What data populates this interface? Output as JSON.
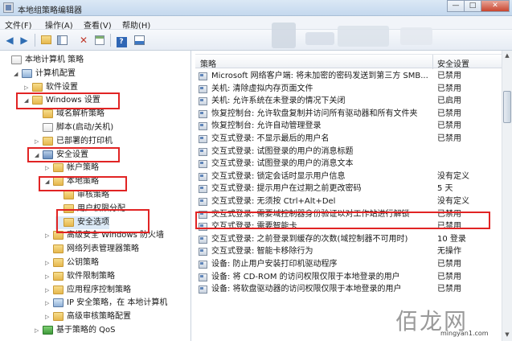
{
  "window": {
    "title": "本地组策略编辑器",
    "controls": [
      "—",
      "□",
      "✕"
    ]
  },
  "menu": [
    "文件(F)",
    "操作(A)",
    "查看(V)",
    "帮助(H)"
  ],
  "toolbar_icons": [
    "back-arrow-icon",
    "forward-arrow-icon",
    "up-folder-icon",
    "show-hide-tree-icon",
    "delete-icon",
    "export-list-icon",
    "help-icon",
    "properties-icon"
  ],
  "tree": [
    {
      "label": "本地计算机 策略",
      "level": 0,
      "icon": "doc",
      "expander": ""
    },
    {
      "label": "计算机配置",
      "level": 1,
      "icon": "computer",
      "expander": "◢"
    },
    {
      "label": "软件设置",
      "level": 2,
      "icon": "folder",
      "expander": "▷"
    },
    {
      "label": "Windows 设置",
      "level": 2,
      "icon": "folder",
      "expander": "◢"
    },
    {
      "label": "域名解析策略",
      "level": 3,
      "icon": "folder",
      "expander": ""
    },
    {
      "label": "脚本(启动/关机)",
      "level": 3,
      "icon": "doc",
      "expander": ""
    },
    {
      "label": "已部署的打印机",
      "level": 3,
      "icon": "folder",
      "expander": "▷"
    },
    {
      "label": "安全设置",
      "level": 3,
      "icon": "shield",
      "expander": "◢"
    },
    {
      "label": "帐户策略",
      "level": 4,
      "icon": "folder",
      "expander": "▷"
    },
    {
      "label": "本地策略",
      "level": 4,
      "icon": "folder",
      "expander": "◢"
    },
    {
      "label": "审核策略",
      "level": 5,
      "icon": "folder",
      "expander": ""
    },
    {
      "label": "用户权限分配",
      "level": 5,
      "icon": "folder",
      "expander": ""
    },
    {
      "label": "安全选项",
      "level": 5,
      "icon": "folder",
      "expander": ""
    },
    {
      "label": "高级安全 Windows 防火墙",
      "level": 4,
      "icon": "folder",
      "expander": "▷"
    },
    {
      "label": "网络列表管理器策略",
      "level": 4,
      "icon": "folder",
      "expander": ""
    },
    {
      "label": "公钥策略",
      "level": 4,
      "icon": "folder",
      "expander": "▷"
    },
    {
      "label": "软件限制策略",
      "level": 4,
      "icon": "folder",
      "expander": "▷"
    },
    {
      "label": "应用程序控制策略",
      "level": 4,
      "icon": "folder",
      "expander": "▷"
    },
    {
      "label": "IP 安全策略，在 本地计算机",
      "level": 4,
      "icon": "computer",
      "expander": "▷"
    },
    {
      "label": "高级审核策略配置",
      "level": 4,
      "icon": "folder",
      "expander": "▷"
    },
    {
      "label": "基于策略的 QoS",
      "level": 3,
      "icon": "chart",
      "expander": "▷"
    }
  ],
  "list": {
    "columns": {
      "policy": "策略",
      "setting": "安全设置"
    },
    "rows": [
      {
        "name": "Microsoft 网络客户端: 将未加密的密码发送到第三方 SMB...",
        "setting": "已禁用"
      },
      {
        "name": "关机: 清除虚拟内存页面文件",
        "setting": "已禁用"
      },
      {
        "name": "关机: 允许系统在未登录的情况下关闭",
        "setting": "已启用"
      },
      {
        "name": "恢复控制台: 允许软盘复制并访问所有驱动器和所有文件夹",
        "setting": "已禁用"
      },
      {
        "name": "恢复控制台: 允许自动管理登录",
        "setting": "已禁用"
      },
      {
        "name": "交互式登录: 不显示最后的用户名",
        "setting": "已禁用"
      },
      {
        "name": "交互式登录: 试图登录的用户的消息标题",
        "setting": ""
      },
      {
        "name": "交互式登录: 试图登录的用户的消息文本",
        "setting": ""
      },
      {
        "name": "交互式登录: 锁定会话时显示用户信息",
        "setting": "没有定义"
      },
      {
        "name": "交互式登录: 提示用户在过期之前更改密码",
        "setting": "5 天"
      },
      {
        "name": "交互式登录: 无须按 Ctrl+Alt+Del",
        "setting": "没有定义"
      },
      {
        "name": "交互式登录: 需要域控制器身份验证以对工作站进行解锁",
        "setting": "已禁用"
      },
      {
        "name": "交互式登录: 需要智能卡",
        "setting": "已禁用"
      },
      {
        "name": "交互式登录: 之前登录到缓存的次数(域控制器不可用时)",
        "setting": "10 登录"
      },
      {
        "name": "交互式登录: 智能卡移除行为",
        "setting": "无操作"
      },
      {
        "name": "设备: 防止用户安装打印机驱动程序",
        "setting": "已禁用"
      },
      {
        "name": "设备: 将 CD-ROM 的访问权限仅限于本地登录的用户",
        "setting": "已禁用"
      },
      {
        "name": "设备: 将软盘驱动器的访问权限仅限于本地登录的用户",
        "setting": "已禁用"
      }
    ]
  },
  "watermark": {
    "glyphs": "佰龙网",
    "url": "mingyan1.com"
  },
  "colors": {
    "highlight": "#e12424"
  }
}
